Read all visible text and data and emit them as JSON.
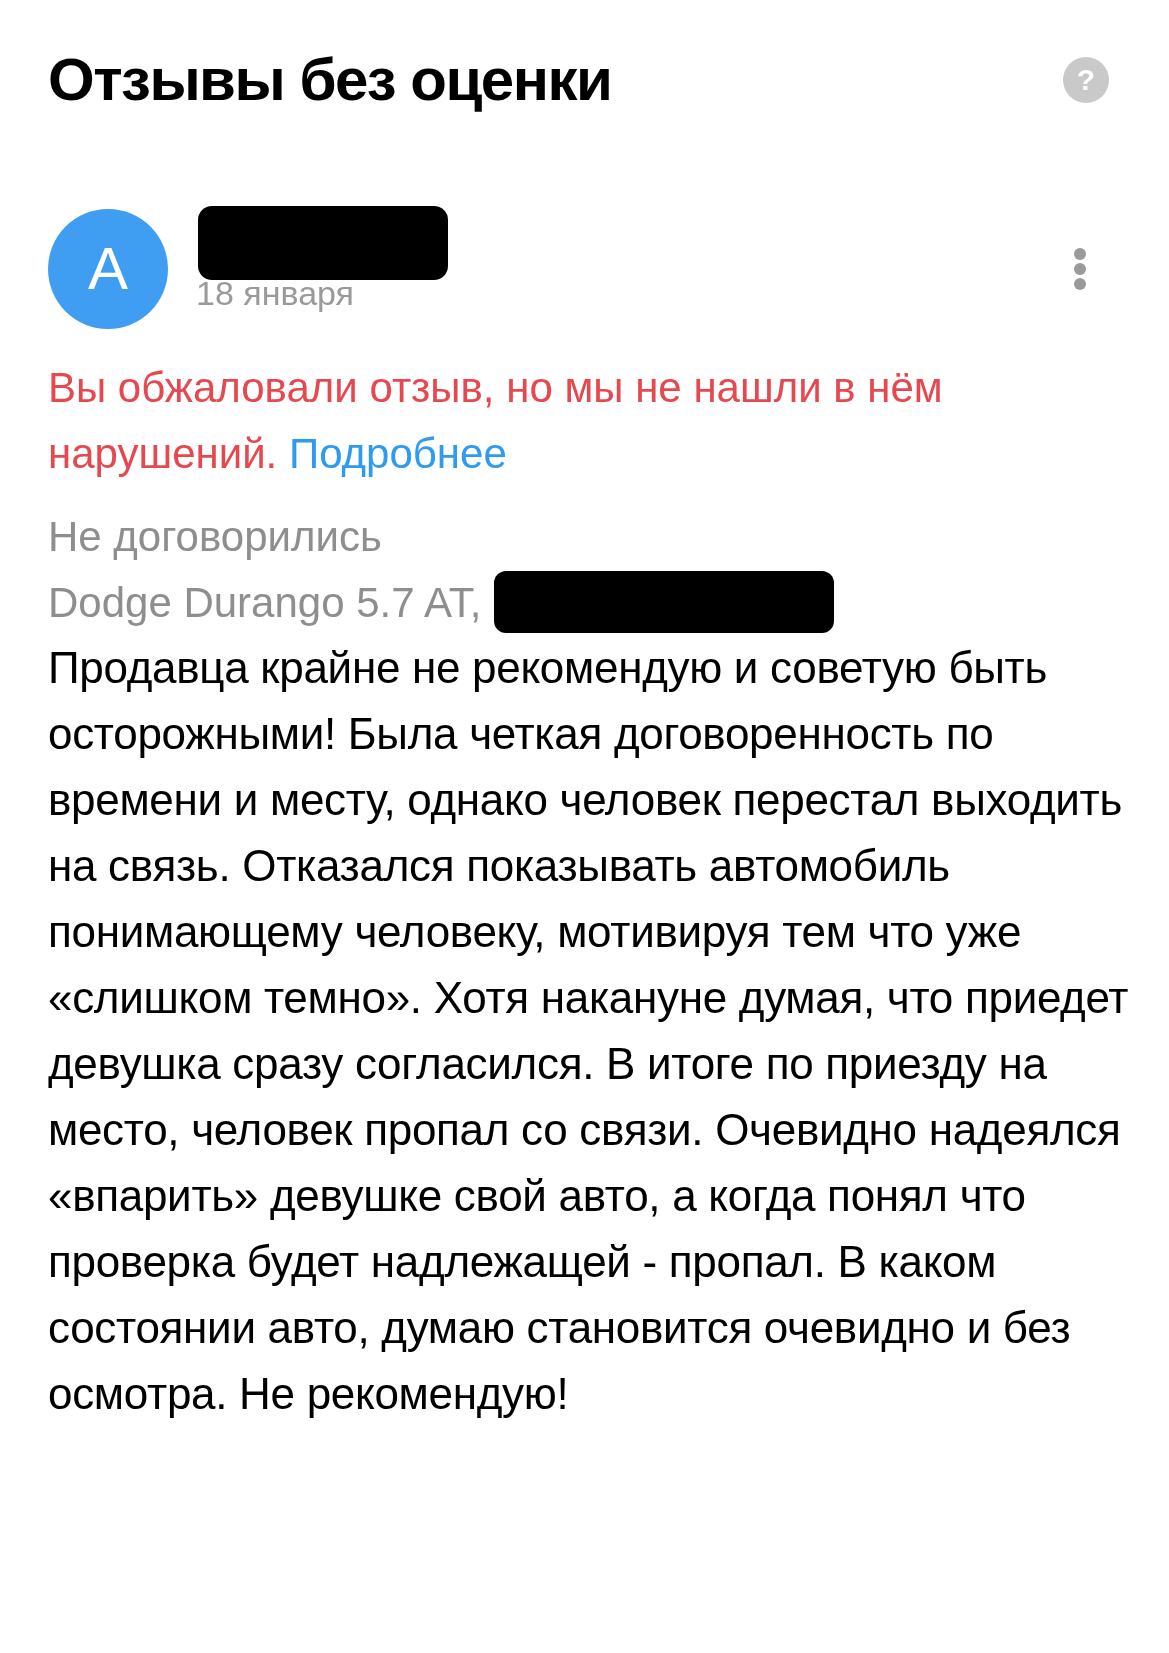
{
  "header": {
    "title": "Отзывы без оценки",
    "help": "?"
  },
  "review": {
    "author": {
      "avatar_letter": "А",
      "name_redacted": true,
      "date": "18 января"
    },
    "notice": {
      "text": "Вы обжаловали отзыв, но мы не нашли в нём нарушений.",
      "link": "Подробнее"
    },
    "status": "Не договорились",
    "item": {
      "text": "Dodge Durango 5.7 AT,",
      "redacted_tail": true
    },
    "body": "Продавца крайне не рекомендую и советую быть осторожными! Была четкая договоренность по времени и месту, однако человек перестал выходить на связь. Отказался показывать автомобиль понимающему человеку, мотивируя тем что уже «слишком темно». Хотя накануне думая, что приедет девушка сразу согласился. В итоге по приезду на место, человек пропал со связи. Очевидно надеялся «впарить» девушке свой авто, а когда понял что проверка будет надлежащей - пропал. В каком состоянии авто, думаю становится очевидно и без осмотра. Не рекомендую!"
  }
}
